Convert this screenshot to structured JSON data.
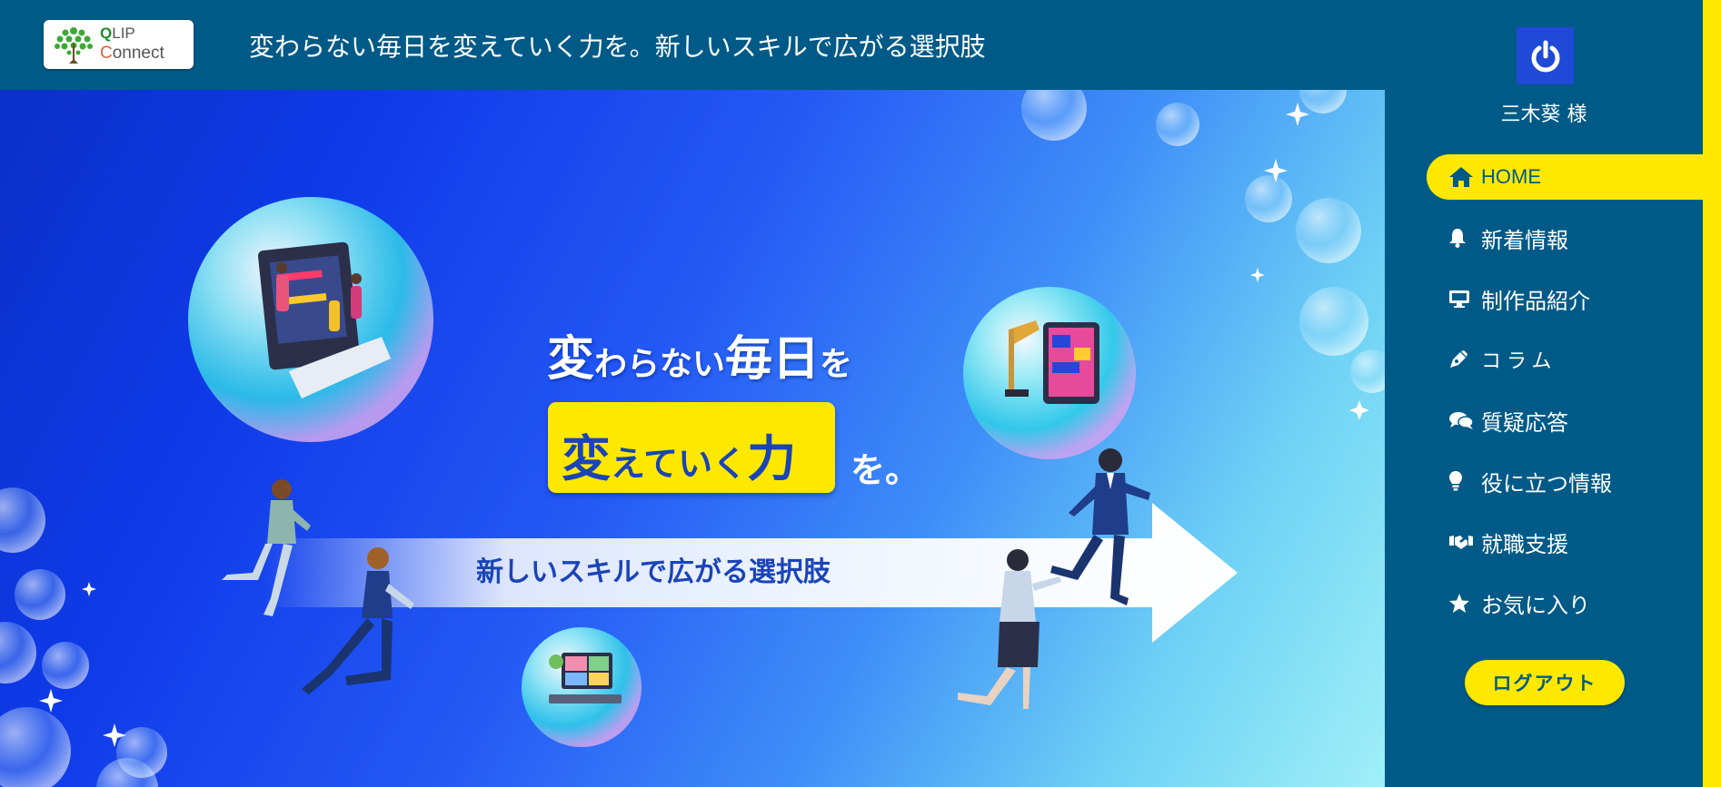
{
  "header": {
    "logo_line1_accent": "Q",
    "logo_line1_rest": "LIP",
    "logo_line2_accent": "C",
    "logo_line2_rest": "onnect",
    "tagline": "変わらない毎日を変えていく力を。新しいスキルで広がる選択肢"
  },
  "hero": {
    "line1": {
      "a": "変",
      "b": "わらない",
      "c": "毎日",
      "d": "を"
    },
    "line2": {
      "a": "変",
      "b": "えていく",
      "c": "力"
    },
    "line2_suffix": "を。",
    "line3": "新しいスキルで広がる選択肢"
  },
  "sidebar": {
    "user_name": "三木葵 様",
    "items": [
      {
        "label": "HOME",
        "icon": "home-icon",
        "active": true
      },
      {
        "label": "新着情報",
        "icon": "bell-icon"
      },
      {
        "label": "制作品紹介",
        "icon": "desktop-icon"
      },
      {
        "label": "コラム",
        "icon": "pen-icon"
      },
      {
        "label": "質疑応答",
        "icon": "comments-icon"
      },
      {
        "label": "役に立つ情報",
        "icon": "lightbulb-icon"
      },
      {
        "label": "就職支援",
        "icon": "handshake-icon"
      },
      {
        "label": "お気に入り",
        "icon": "star-icon"
      }
    ],
    "logout_label": "ログアウト"
  },
  "colors": {
    "header_bg": "#005a87",
    "accent_yellow": "#ffe800",
    "hero_blue": "#0f3ae8",
    "text_blue": "#1a44b8"
  }
}
